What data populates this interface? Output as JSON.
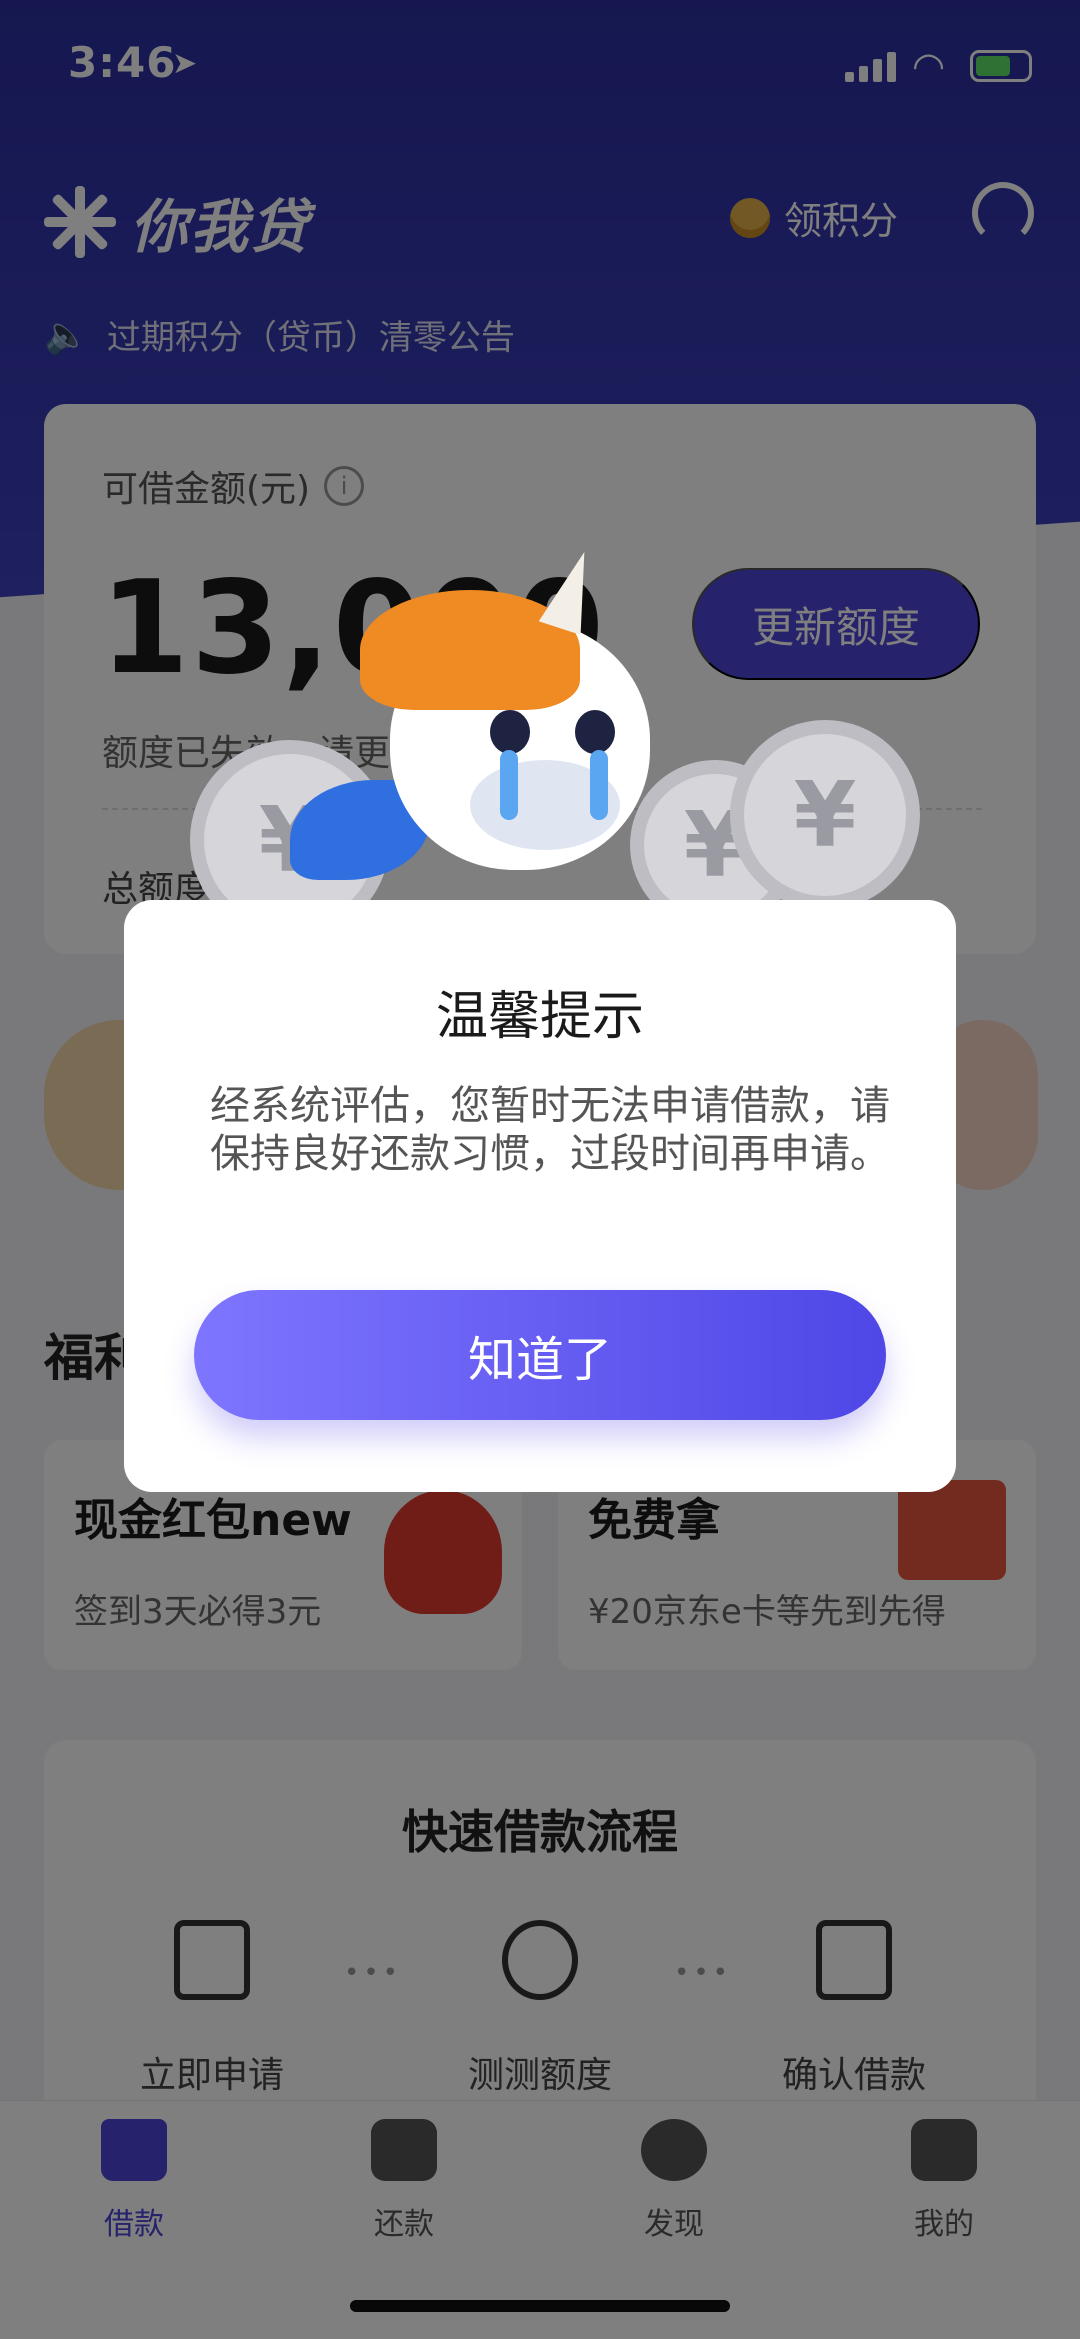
{
  "status_bar": {
    "time": "3:46"
  },
  "header": {
    "logo_text": "你我贷",
    "points_label": "领积分"
  },
  "notice": {
    "text": "过期积分（贷币）清零公告"
  },
  "quota_card": {
    "label": "可借金额(元)",
    "amount": "13,000",
    "refresh_label": "更新额度",
    "hint": "额度已失效，请更",
    "total_label": "总额度"
  },
  "welfare": {
    "title": "福利",
    "cards": [
      {
        "name": "现金红包new",
        "desc": "签到3天必得3元"
      },
      {
        "name": "免费拿",
        "desc": "¥20京东e卡等先到先得"
      }
    ]
  },
  "flow": {
    "title": "快速借款流程",
    "steps": [
      "立即申请",
      "测测额度",
      "确认借款"
    ]
  },
  "tabbar": {
    "tabs": [
      "借款",
      "还款",
      "发现",
      "我的"
    ]
  },
  "dialog": {
    "title": "温馨提示",
    "message": "经系统评估，您暂时无法申请借款，请保持良好还款习惯，过段时间再申请。",
    "confirm_label": "知道了"
  },
  "colors": {
    "brand": "#4c45d6",
    "hero": "#3f43c4",
    "dialog_button_start": "#7e75ff",
    "dialog_button_end": "#4f47e6"
  }
}
